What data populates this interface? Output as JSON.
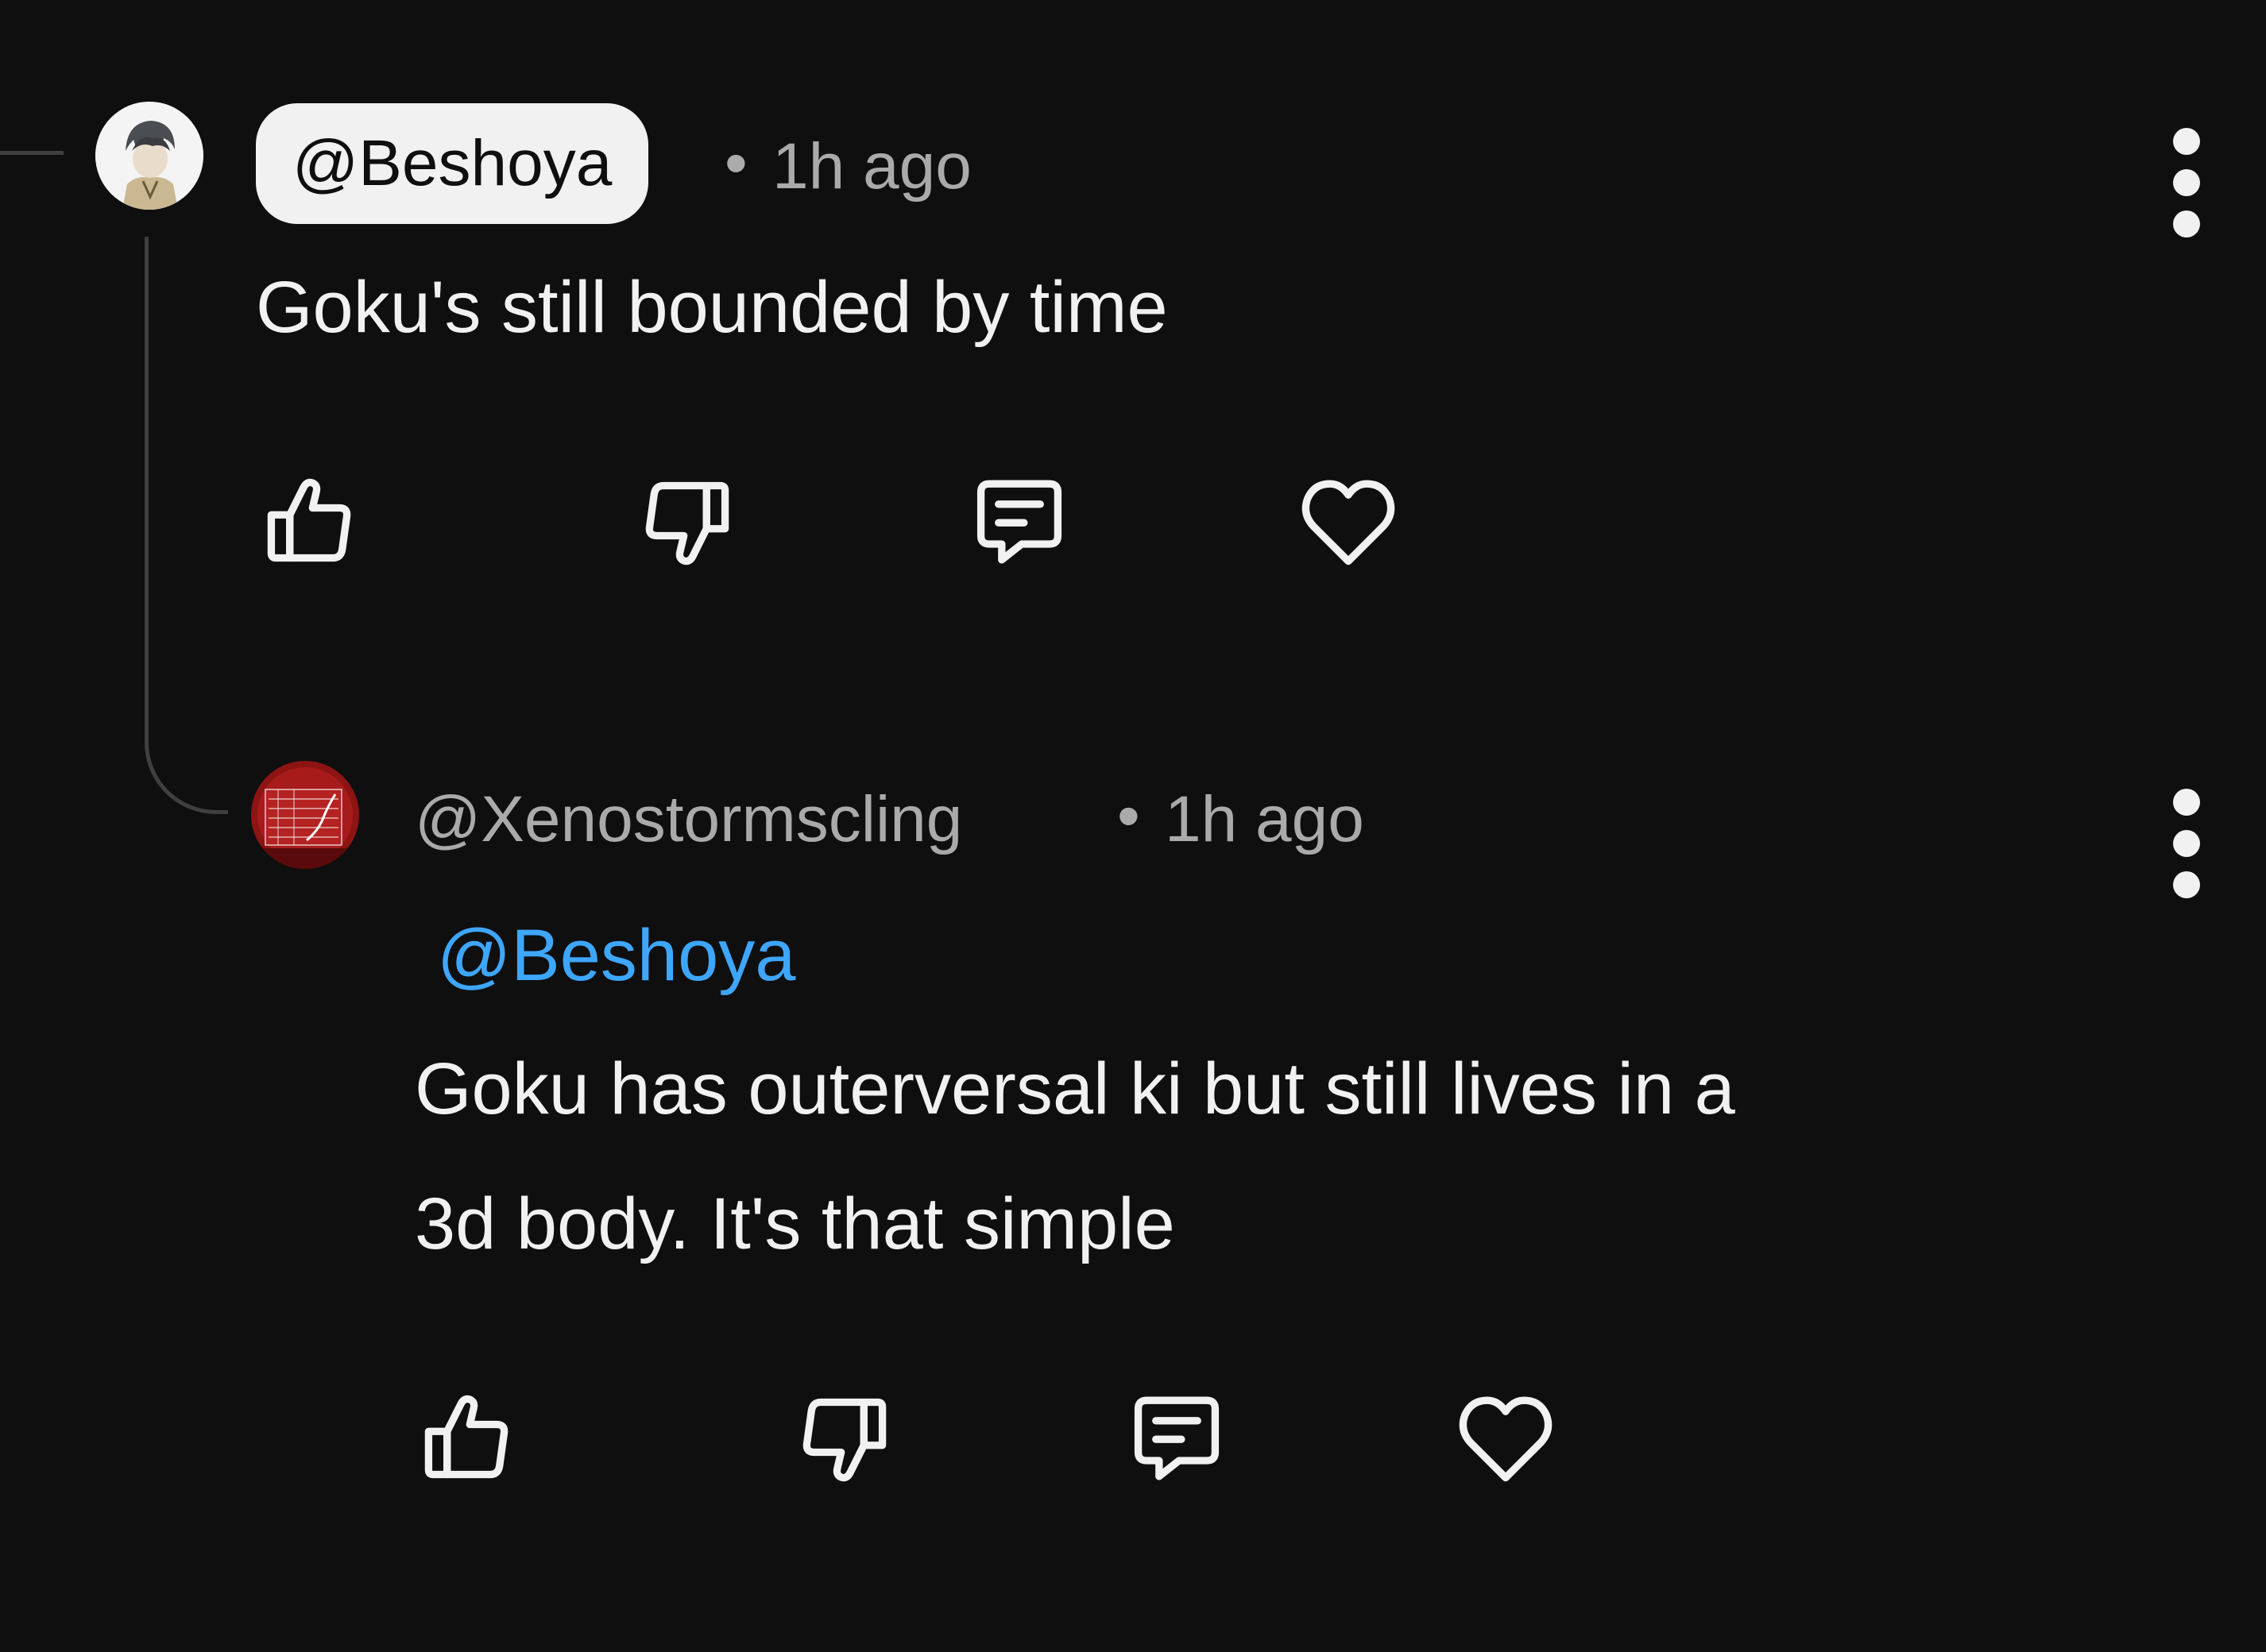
{
  "comments": [
    {
      "handle": "@Beshoya",
      "separator": "•",
      "time": "1h ago",
      "text_lines": [
        "Goku's still bounded by time"
      ],
      "more_icon": "more-vert-icon"
    },
    {
      "handle": "@Xenostormscling",
      "separator": "•",
      "time": "1h ago",
      "mention": "@Beshoya",
      "text_lines": [
        "Goku has outerversal ki but still lives in a",
        "3d body. It's that simple"
      ],
      "more_icon": "more-vert-icon"
    }
  ],
  "actions": {
    "like_icon": "thumbs-up-icon",
    "dislike_icon": "thumbs-down-icon",
    "reply_icon": "reply-comment-icon",
    "heart_icon": "heart-icon"
  },
  "colors": {
    "background": "#0f0f0f",
    "text": "#f1f1f1",
    "meta": "#aaaaaa",
    "mention": "#3ea6ff",
    "thread_line": "#3f3f3f"
  }
}
